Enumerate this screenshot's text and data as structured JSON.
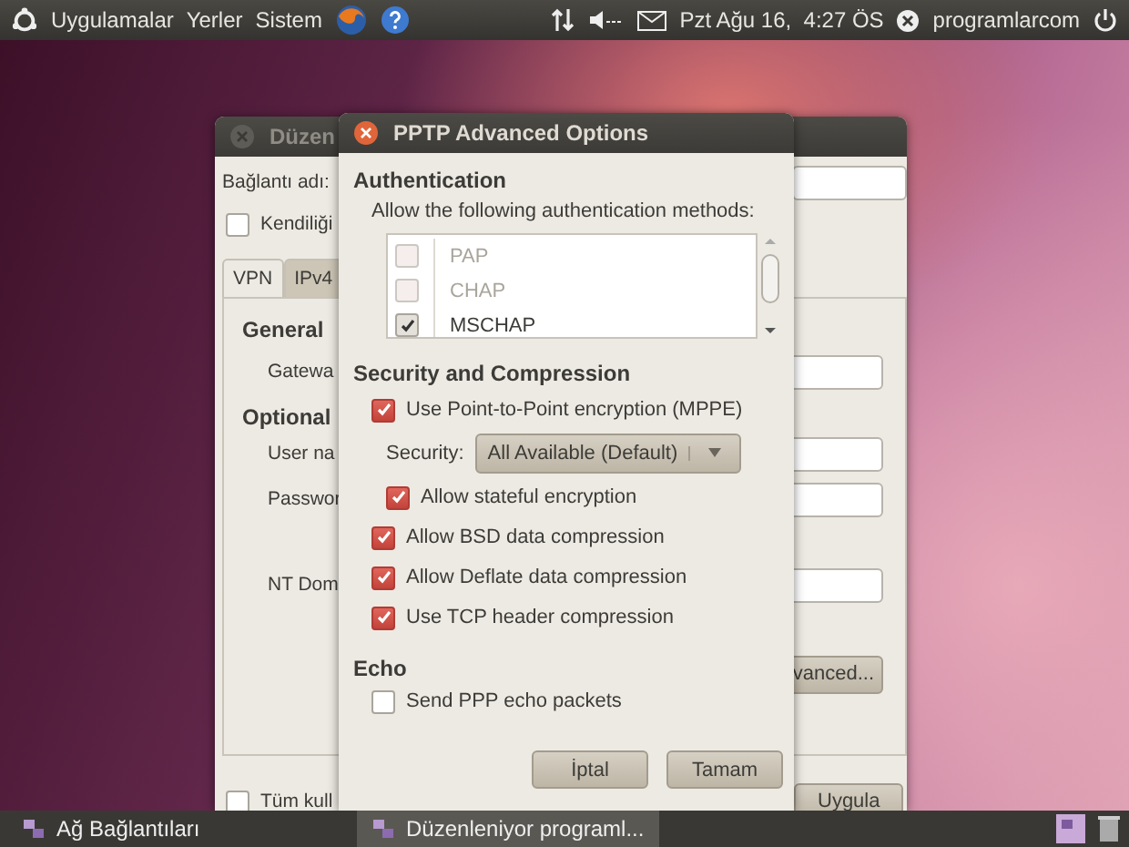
{
  "top_panel": {
    "menus": [
      "Uygulamalar",
      "Yerler",
      "Sistem"
    ],
    "clock": "Pzt Ağu 16,  4:27 ÖS",
    "user": "programlarcom"
  },
  "background_window": {
    "title": "Düzen",
    "name_label": "Bağlantı adı:",
    "auto_connect": {
      "label": "Kendiliği",
      "checked": false
    },
    "tabs": [
      {
        "label": "VPN",
        "selected": true
      },
      {
        "label": "IPv4",
        "selected": false
      }
    ],
    "general_heading": "General",
    "gateway_label": "Gatewa",
    "optional_heading": "Optional",
    "user_label": "User na",
    "password_label": "Passwor",
    "domain_label": "NT Dom",
    "advanced_button": "vanced...",
    "all_users": {
      "label": "Tüm kull",
      "checked": false
    },
    "apply_button": "Uygula"
  },
  "dialog": {
    "title": "PPTP Advanced Options",
    "auth_heading": "Authentication",
    "auth_hint": "Allow the following authentication methods:",
    "methods": [
      {
        "label": "PAP",
        "checked": false,
        "disabled": true
      },
      {
        "label": "CHAP",
        "checked": false,
        "disabled": true
      },
      {
        "label": "MSCHAP",
        "checked": true,
        "disabled": false
      }
    ],
    "security_heading": "Security and Compression",
    "options": [
      {
        "kind": "check",
        "label": "Use Point-to-Point encryption (MPPE)",
        "checked": true,
        "children": [
          {
            "kind": "select",
            "label": "Security:",
            "value": "All Available (Default)"
          },
          {
            "kind": "check",
            "label": "Allow stateful encryption",
            "checked": true
          }
        ]
      },
      {
        "kind": "check",
        "label": "Allow BSD data compression",
        "checked": true
      },
      {
        "kind": "check",
        "label": "Allow Deflate data compression",
        "checked": true
      },
      {
        "kind": "check",
        "label": "Use TCP header compression",
        "checked": true
      }
    ],
    "echo_heading": "Echo",
    "echo": {
      "label": "Send PPP echo packets",
      "checked": false
    },
    "buttons": [
      "İptal",
      "Tamam"
    ]
  },
  "taskbar": [
    {
      "label": "Ağ Bağlantıları",
      "selected": false
    },
    {
      "label": "Düzenleniyor programl...",
      "selected": true
    }
  ]
}
